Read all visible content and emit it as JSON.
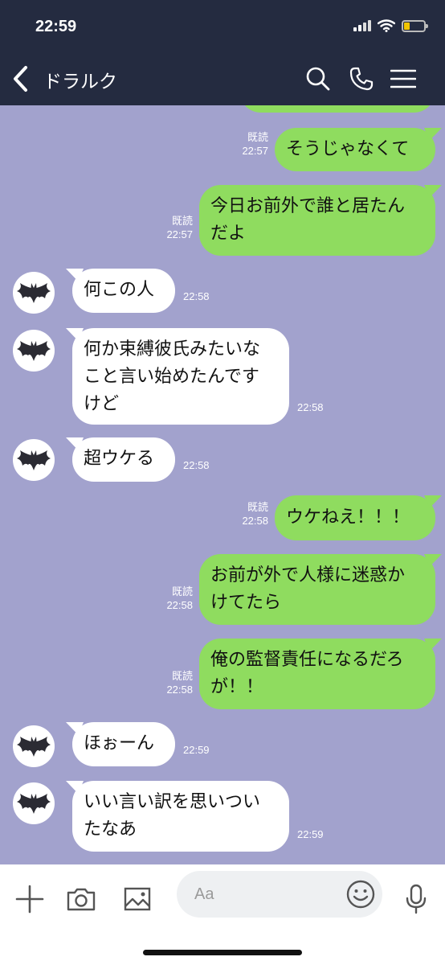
{
  "status": {
    "time": "22:59"
  },
  "header": {
    "title": "ドラルク"
  },
  "messages": [
    {
      "dir": "out",
      "lines": [
        "そうじゃなくて"
      ],
      "read": "既読",
      "time": "22:57"
    },
    {
      "dir": "out",
      "lines": [
        "今日お前外で誰と居たん",
        "だよ"
      ],
      "read": "既読",
      "time": "22:57"
    },
    {
      "dir": "in",
      "lines": [
        "何この人"
      ],
      "time": "22:58"
    },
    {
      "dir": "in",
      "lines": [
        "何か束縛彼氏みたいな",
        "こと言い始めたんです",
        "けど"
      ],
      "time": "22:58"
    },
    {
      "dir": "in",
      "lines": [
        "超ウケる"
      ],
      "time": "22:58"
    },
    {
      "dir": "out",
      "lines": [
        "ウケねえ！！！"
      ],
      "read": "既読",
      "time": "22:58"
    },
    {
      "dir": "out",
      "lines": [
        "お前が外で人様に迷惑か",
        "けてたら"
      ],
      "read": "既読",
      "time": "22:58"
    },
    {
      "dir": "out",
      "lines": [
        "俺の監督責任になるだろ",
        "が！！"
      ],
      "read": "既読",
      "time": "22:58"
    },
    {
      "dir": "in",
      "lines": [
        "ほぉーん"
      ],
      "time": "22:59"
    },
    {
      "dir": "in",
      "lines": [
        "いい言い訳を思いつい",
        "たなあ"
      ],
      "time": "22:59"
    }
  ],
  "input": {
    "placeholder": "Aa"
  },
  "icons": {
    "back": "chevron-left-icon",
    "search": "search-icon",
    "call": "phone-icon",
    "menu": "hamburger-menu-icon",
    "avatar": "bat-icon",
    "add": "plus-icon",
    "camera": "camera-icon",
    "image": "image-icon",
    "emoji": "smiley-icon",
    "mic": "microphone-icon"
  },
  "colors": {
    "header_bg": "#242b40",
    "chat_bg": "#a2a2cd",
    "outgoing_bubble": "#8fdc5f",
    "incoming_bubble": "#ffffff",
    "battery_fill": "#f2c500"
  }
}
